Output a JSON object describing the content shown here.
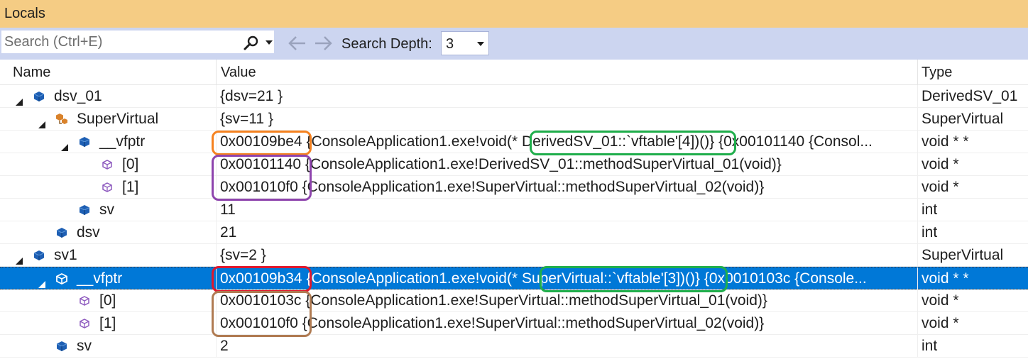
{
  "window": {
    "title": "Locals"
  },
  "toolbar": {
    "search_placeholder": "Search (Ctrl+E)",
    "depth_label": "Search Depth:",
    "depth_value": "3"
  },
  "columns": {
    "name": "Name",
    "value": "Value",
    "type": "Type"
  },
  "rows": [
    {
      "name": "dsv_01",
      "value": "{dsv=21 }",
      "type": "DerivedSV_01",
      "level": 0,
      "expanded": true,
      "icon": "object-icon"
    },
    {
      "name": "SuperVirtual",
      "value": "{sv=11 }",
      "type": "SuperVirtual",
      "level": 1,
      "expanded": true,
      "icon": "base-class-icon"
    },
    {
      "name": "__vfptr",
      "value": "0x00109be4 {ConsoleApplication1.exe!void(* DerivedSV_01::`vftable'[4])()} {0x00101140 {Consol...",
      "type": "void * *",
      "level": 2,
      "expanded": true,
      "icon": "field-icon"
    },
    {
      "name": "[0]",
      "value": "0x00101140 {ConsoleApplication1.exe!DerivedSV_01::methodSuperVirtual_01(void)}",
      "type": "void *",
      "level": 3,
      "expanded": false,
      "icon": "pointer-icon"
    },
    {
      "name": "[1]",
      "value": "0x001010f0 {ConsoleApplication1.exe!SuperVirtual::methodSuperVirtual_02(void)}",
      "type": "void *",
      "level": 3,
      "expanded": false,
      "icon": "pointer-icon"
    },
    {
      "name": "sv",
      "value": "11",
      "type": "int",
      "level": 2,
      "expanded": false,
      "icon": "field-icon"
    },
    {
      "name": "dsv",
      "value": "21",
      "type": "int",
      "level": 1,
      "expanded": false,
      "icon": "field-icon"
    },
    {
      "name": "sv1",
      "value": "{sv=2 }",
      "type": "SuperVirtual",
      "level": 0,
      "expanded": true,
      "icon": "object-icon"
    },
    {
      "name": "__vfptr",
      "value": "0x00109b34 {ConsoleApplication1.exe!void(* SuperVirtual::`vftable'[3])()} {0x0010103c {Console...",
      "type": "void * *",
      "level": 1,
      "expanded": true,
      "icon": "field-icon",
      "selected": true
    },
    {
      "name": "[0]",
      "value": "0x0010103c {ConsoleApplication1.exe!SuperVirtual::methodSuperVirtual_01(void)}",
      "type": "void *",
      "level": 2,
      "expanded": false,
      "icon": "pointer-icon"
    },
    {
      "name": "[1]",
      "value": "0x001010f0 {ConsoleApplication1.exe!SuperVirtual::methodSuperVirtual_02(void)}",
      "type": "void *",
      "level": 2,
      "expanded": false,
      "icon": "pointer-icon"
    },
    {
      "name": "sv",
      "value": "2",
      "type": "int",
      "level": 1,
      "expanded": false,
      "icon": "field-icon"
    }
  ],
  "colors": {
    "title_bar": "#f5cc84",
    "toolbar": "#ccd5f0",
    "selection": "#0078d7",
    "icon_blue": "#1e5fb4",
    "mark_orange": "#f58220",
    "mark_green": "#1fae4b",
    "mark_purple": "#8e44ad",
    "mark_red": "#e0182d",
    "mark_brown": "#b07b52"
  }
}
